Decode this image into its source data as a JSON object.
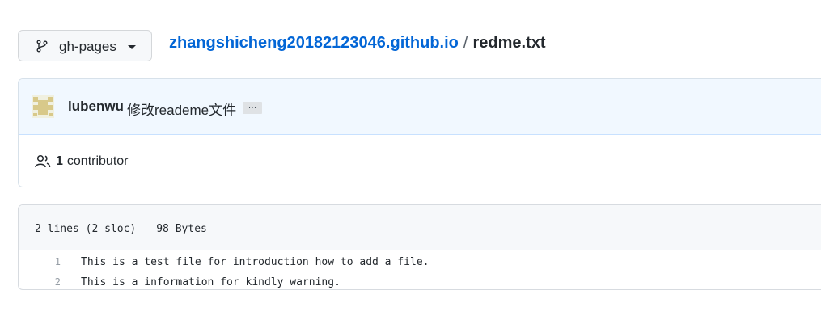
{
  "branch_selector": {
    "label": "gh-pages",
    "icon": "git-branch-icon"
  },
  "breadcrumb": {
    "repo": "zhangshicheng20182123046.github.io",
    "separator": "/",
    "file": "redme.txt"
  },
  "commit": {
    "author": "lubenwu",
    "message": "修改reademe文件",
    "ellipsis": "…",
    "avatar_icon": "identicon-avatar"
  },
  "contributors": {
    "icon": "people-icon",
    "count": "1",
    "label": "contributor"
  },
  "file": {
    "lines_info": "2 lines (2 sloc)",
    "size": "98 Bytes",
    "lines": [
      {
        "num": "1",
        "text": "This is a test file for introduction how to add a file."
      },
      {
        "num": "2",
        "text": "This is a information for kindly warning."
      }
    ]
  },
  "colors": {
    "link": "#0366d6",
    "commit_header_bg": "#f1f8ff",
    "file_header_bg": "#f6f8fa"
  }
}
